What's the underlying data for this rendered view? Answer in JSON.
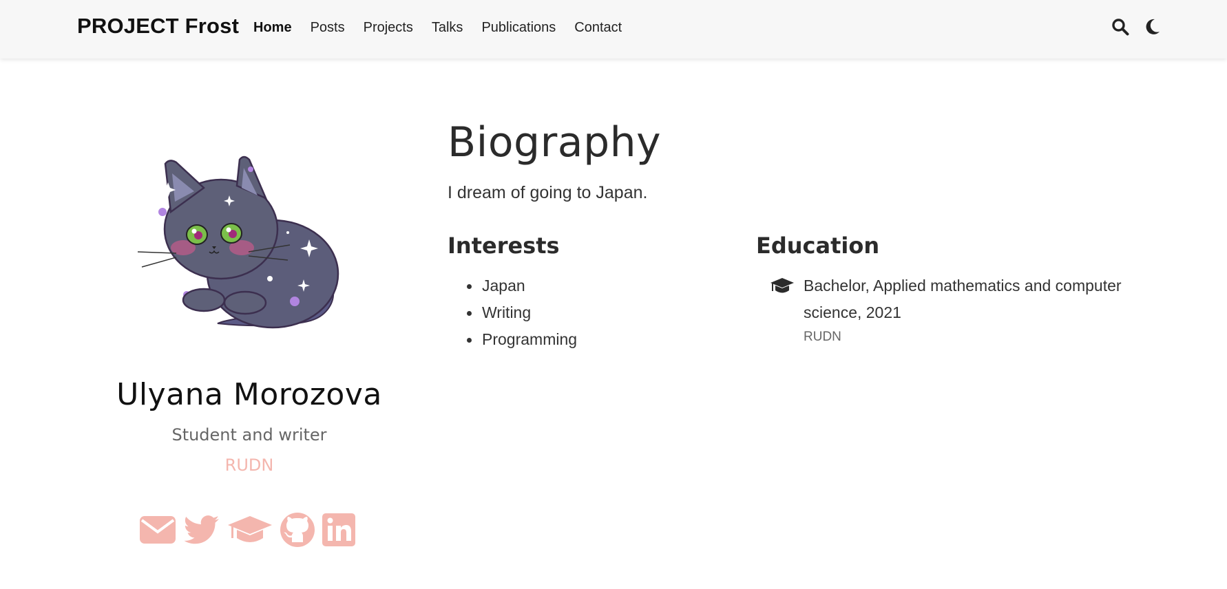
{
  "navbar": {
    "brand": "PROJECT Frost",
    "links": [
      "Home",
      "Posts",
      "Projects",
      "Talks",
      "Publications",
      "Contact"
    ],
    "active": "Home",
    "icons": [
      "search-icon",
      "moon-icon"
    ]
  },
  "profile": {
    "name": "Ulyana Morozova",
    "role": "Student and writer",
    "organization": "RUDN",
    "avatar": "cat-illustration",
    "social_icons": [
      "envelope-icon",
      "twitter-icon",
      "graduation-cap-icon",
      "github-icon",
      "linkedin-icon"
    ]
  },
  "biography": {
    "title": "Biography",
    "text": "I dream of going to Japan."
  },
  "interests": {
    "title": "Interests",
    "items": [
      "Japan",
      "Writing",
      "Programming"
    ]
  },
  "education": {
    "title": "Education",
    "items": [
      {
        "course": "Bachelor, Applied mathematics and computer science, 2021",
        "institution": "RUDN",
        "icon": "graduation-cap-icon"
      }
    ]
  },
  "colors": {
    "accent": "#f4b6ae",
    "navbar_bg": "#f7f7f7",
    "text": "#2b2b2b"
  }
}
